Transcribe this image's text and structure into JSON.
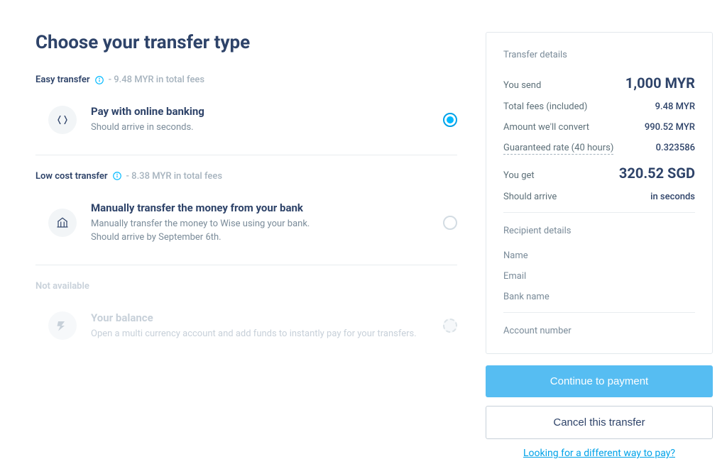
{
  "title": "Choose your transfer type",
  "groups": {
    "easy": {
      "label": "Easy transfer",
      "fees": "- 9.48 MYR in total fees",
      "option": {
        "title": "Pay with online banking",
        "desc": "Should arrive in seconds."
      }
    },
    "low": {
      "label": "Low cost transfer",
      "fees": "- 8.38 MYR in total fees",
      "option": {
        "title": "Manually transfer the money from your bank",
        "desc1": "Manually transfer the money to Wise using your bank.",
        "desc2": "Should arrive by September 6th."
      }
    },
    "na": {
      "label": "Not available",
      "option": {
        "title": "Your balance",
        "desc": "Open a multi currency account and add funds to instantly pay for your transfers."
      }
    }
  },
  "details": {
    "heading": "Transfer details",
    "you_send_label": "You send",
    "you_send_value": "1,000 MYR",
    "fees_label": "Total fees (included)",
    "fees_value": "9.48 MYR",
    "convert_label": "Amount we'll convert",
    "convert_value": "990.52 MYR",
    "rate_label": "Guaranteed rate (40 hours)",
    "rate_value": "0.323586",
    "you_get_label": "You get",
    "you_get_value": "320.52 SGD",
    "arrive_label": "Should arrive",
    "arrive_value": "in seconds",
    "recipient_heading": "Recipient details",
    "name_label": "Name",
    "email_label": "Email",
    "bank_label": "Bank name",
    "account_label": "Account number"
  },
  "buttons": {
    "continue": "Continue to payment",
    "cancel": "Cancel this transfer",
    "alt": "Looking for a different way to pay?"
  }
}
